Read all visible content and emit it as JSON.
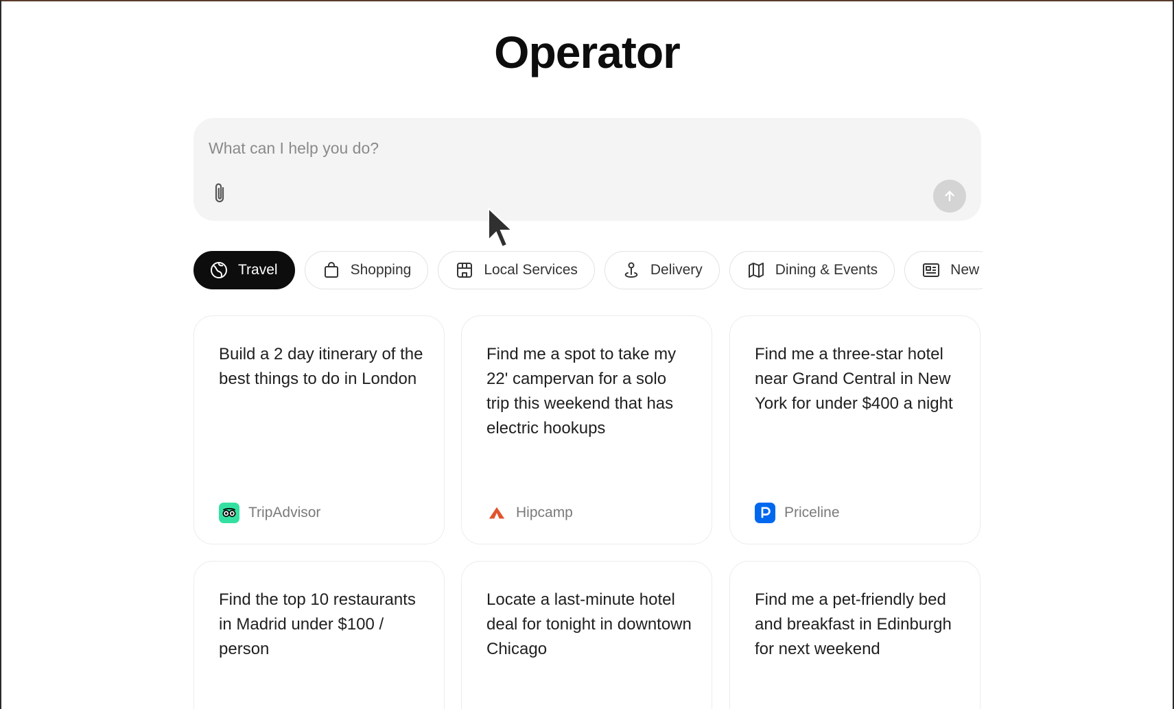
{
  "app": {
    "title": "Operator"
  },
  "composer": {
    "placeholder": "What can I help you do?"
  },
  "categories": [
    {
      "label": "Travel",
      "icon": "travel-icon",
      "active": true
    },
    {
      "label": "Shopping",
      "icon": "shopping-bag-icon",
      "active": false
    },
    {
      "label": "Local Services",
      "icon": "storefront-icon",
      "active": false
    },
    {
      "label": "Delivery",
      "icon": "location-pin-icon",
      "active": false
    },
    {
      "label": "Dining & Events",
      "icon": "map-icon",
      "active": false
    },
    {
      "label": "New",
      "icon": "newspaper-icon",
      "active": false
    }
  ],
  "cards": [
    {
      "text": "Build a 2 day itinerary of the best things to do in London",
      "source": "TripAdvisor",
      "logo": "tripadvisor-logo-icon"
    },
    {
      "text": "Find me a spot to take my 22' campervan for a solo trip this weekend that has electric hookups",
      "source": "Hipcamp",
      "logo": "hipcamp-logo-icon"
    },
    {
      "text": "Find me a three-star hotel near Grand Central in New York for under $400 a night",
      "source": "Priceline",
      "logo": "priceline-logo-icon"
    },
    {
      "text": "Find the top 10 restaurants in Madrid under $100 / person"
    },
    {
      "text": "Locate a last-minute hotel deal for tonight in downtown Chicago"
    },
    {
      "text": "Find me a pet-friendly bed and breakfast in Edinburgh for next weekend"
    }
  ],
  "colors": {
    "active_chip": "#0d0d0d",
    "tripadvisor": "#34e0a1",
    "hipcamp": "#e0552e",
    "priceline": "#0068ef"
  }
}
